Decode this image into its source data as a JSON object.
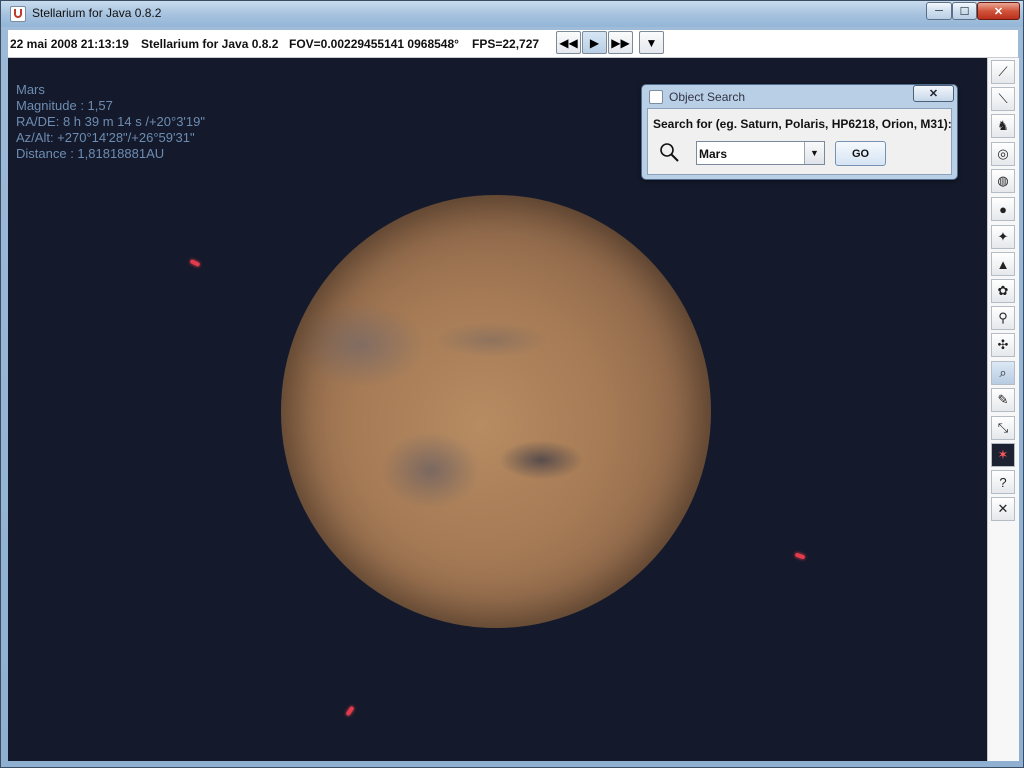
{
  "window": {
    "title": "Stellarium for Java 0.8.2",
    "minimize": "─",
    "maximize": "☐",
    "close": "✕"
  },
  "toolbar": {
    "datetime": "22 mai 2008 21:13:19",
    "app_name": "Stellarium for Java 0.8.2",
    "fov": "FOV=0.00229455141 0968548°",
    "fps": "FPS=22,727",
    "rewind": "◀◀",
    "play": "▶",
    "forward": "▶▶",
    "realtime": "▼"
  },
  "object_info": {
    "name": "Mars",
    "magnitude": "Magnitude : 1,57",
    "radec": "RA/DE: 8 h 39 m 14 s /+20°3'19\"",
    "azalt": "Az/Alt: +270°14'28\"/+26°59'31\"",
    "distance": "Distance : 1,81818881AU"
  },
  "search_dialog": {
    "title": "Object Search",
    "close": "✕",
    "label": "Search for (eg. Saturn, Polaris, HP6218, Orion, M31):",
    "value": "Mars",
    "go": "GO"
  },
  "sidebar": [
    {
      "name": "constellation-lines-icon",
      "glyph": "⟋"
    },
    {
      "name": "constellation-names-icon",
      "glyph": "⟍"
    },
    {
      "name": "constellation-art-icon",
      "glyph": "♞"
    },
    {
      "name": "azimuthal-grid-icon",
      "glyph": "◎"
    },
    {
      "name": "equatorial-grid-icon",
      "glyph": "◍"
    },
    {
      "name": "ground-icon",
      "glyph": "●"
    },
    {
      "name": "cardinal-points-icon",
      "glyph": "✦"
    },
    {
      "name": "atmosphere-icon",
      "glyph": "▲"
    },
    {
      "name": "nebulae-icon",
      "glyph": "✿"
    },
    {
      "name": "telescope-icon",
      "glyph": "⚲"
    },
    {
      "name": "fullscreen-icon",
      "glyph": "✣"
    },
    {
      "name": "search-icon",
      "glyph": "⌕"
    },
    {
      "name": "config-icon",
      "glyph": "✎"
    },
    {
      "name": "mount-icon",
      "glyph": "⤡"
    },
    {
      "name": "night-mode-icon",
      "glyph": "✶"
    },
    {
      "name": "help-icon",
      "glyph": "?"
    },
    {
      "name": "quit-icon",
      "glyph": "✕"
    }
  ]
}
